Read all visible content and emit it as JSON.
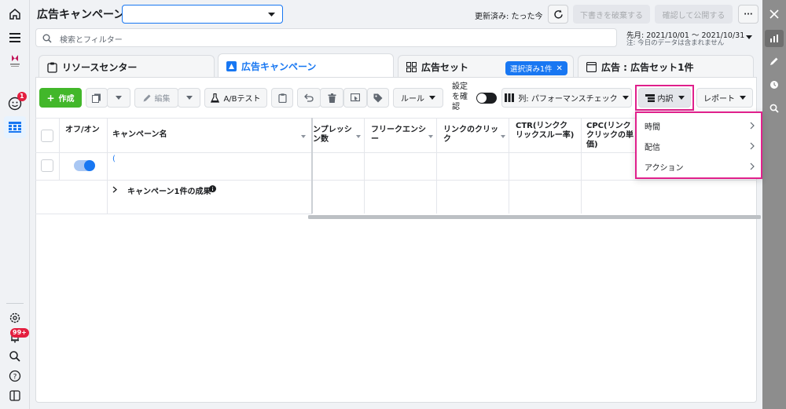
{
  "header": {
    "title": "広告キャンペーン",
    "campaign_select_value": "",
    "status": "更新済み: たった今",
    "discard_label": "下書きを破棄する",
    "publish_label": "確認して公開する",
    "more_label": "···"
  },
  "search": {
    "placeholder": "検索とフィルター"
  },
  "date_range": {
    "range": "先月: 2021/10/01 〜 2021/10/31",
    "note": "注: 今日のデータは含まれません"
  },
  "tabs": [
    {
      "label": "リソースセンター"
    },
    {
      "label": "広告キャンペーン"
    },
    {
      "label": "広告セット"
    },
    {
      "label": "広告 : 広告セット1件"
    }
  ],
  "selected_chip": "選択済み1件",
  "toolbar": {
    "create_label": "作成",
    "edit_label": "編集",
    "ab_test_label": "A/Bテスト",
    "rules_label": "ルール",
    "settings_check_label": "設定を確認",
    "columns_label": "列: パフォーマンスチェック",
    "breakdown_label": "内訳",
    "report_label": "レポート"
  },
  "table": {
    "headers": {
      "onoff": "オフ/オン",
      "campaign_name": "キャンペーン名",
      "impressions": "インプレッション数",
      "frequency": "フリークエンシー",
      "link_clicks": "リンクのクリック",
      "ctr": "CTR(リンククリックスルー率)",
      "cpc": "CPC(リンククリックの単価)"
    },
    "row1_name": "(",
    "summary_label": "キャンペーン1件の成果"
  },
  "breakdown_menu": {
    "items": [
      {
        "label": "時間"
      },
      {
        "label": "配信"
      },
      {
        "label": "アクション"
      }
    ]
  },
  "left_rail": {
    "notification_badge": "1",
    "alerts_badge": "99+"
  },
  "colors": {
    "brand_blue": "#1877f2",
    "create_green": "#42b72a",
    "highlight_magenta": "#e0208c",
    "badge_red": "#e41e3f"
  }
}
